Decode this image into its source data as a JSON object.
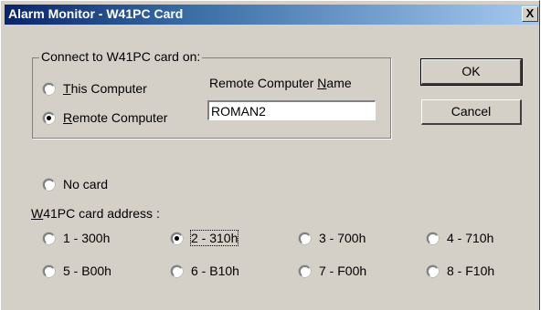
{
  "window": {
    "title": "Alarm Monitor - W41PC Card",
    "close_glyph": "X"
  },
  "connect_group": {
    "title": "Connect to W41PC card on:",
    "this_computer": {
      "first": "T",
      "rest": "his Computer",
      "checked": false
    },
    "remote_computer": {
      "first": "R",
      "rest": "emote Computer",
      "checked": true
    },
    "remote_name_label": {
      "pre": "Remote Computer ",
      "u": "N",
      "post": "ame"
    },
    "remote_name_value": "ROMAN2"
  },
  "buttons": {
    "ok": "OK",
    "cancel": "Cancel"
  },
  "no_card": {
    "label": "No card",
    "checked": false
  },
  "address": {
    "label_first": "W",
    "label_rest": "41PC card address :",
    "options": [
      {
        "label": "1 - 300h",
        "checked": false
      },
      {
        "label": "2 - 310h",
        "checked": true
      },
      {
        "label": "3 - 700h",
        "checked": false
      },
      {
        "label": "4 - 710h",
        "checked": false
      },
      {
        "label": "5 - B00h",
        "checked": false
      },
      {
        "label": "6 - B10h",
        "checked": false
      },
      {
        "label": "7 - F00h",
        "checked": false
      },
      {
        "label": "8 - F10h",
        "checked": false
      }
    ]
  }
}
